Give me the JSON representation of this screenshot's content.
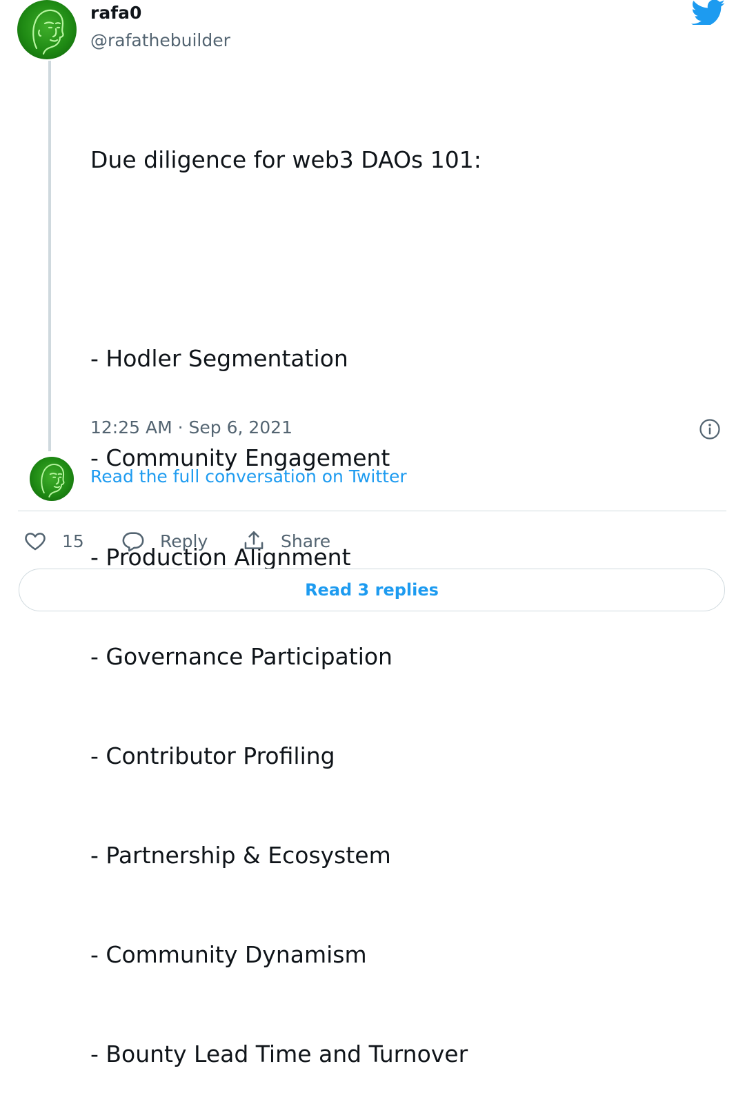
{
  "author": {
    "display_name": "rafa0",
    "handle": "@rafathebuilder",
    "avatar_icon": "green-face-avatar-icon"
  },
  "brand": {
    "logo_icon": "twitter-bird-icon",
    "accent_color": "#1d9bf0"
  },
  "tweet": {
    "lines": [
      "Due diligence for web3 DAOs 101:",
      "",
      "- Hodler Segmentation",
      "- Community Engagement",
      "- Production Alignment",
      "- Governance Participation",
      "- Contributor Profiling",
      "- Partnership & Ecosystem",
      "- Community Dynamism",
      "- Bounty Lead Time and Turnover"
    ],
    "timestamp": "12:25 AM · Sep 6, 2021"
  },
  "thread": {
    "read_full_conversation": "Read the full conversation on Twitter"
  },
  "actions": {
    "like_count": "15",
    "reply_label": "Reply",
    "share_label": "Share"
  },
  "footer": {
    "read_replies_label": "Read 3 replies"
  }
}
